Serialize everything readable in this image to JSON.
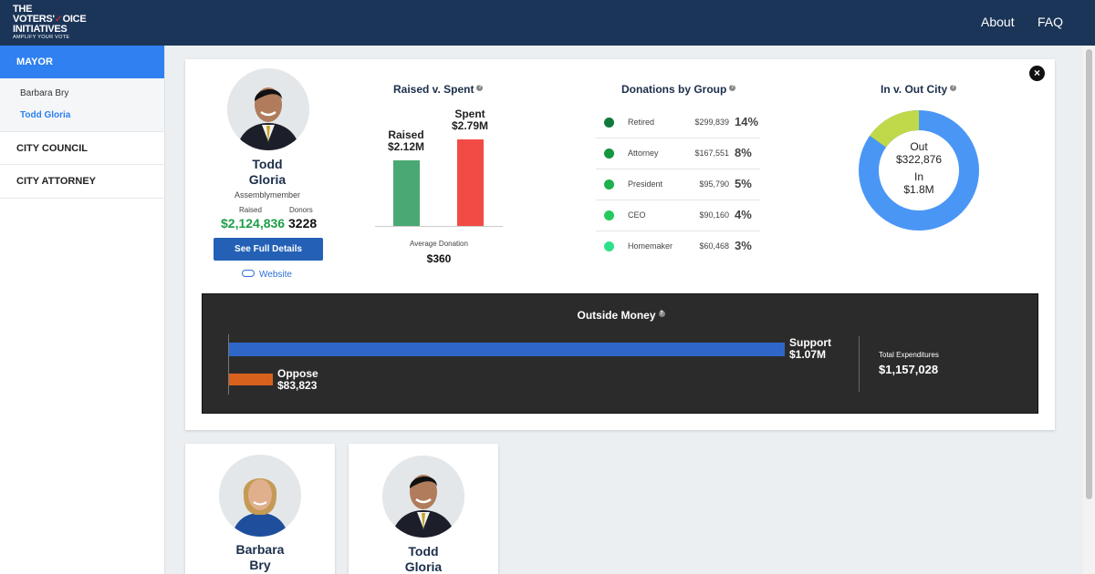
{
  "logo": {
    "line1": "THE",
    "line2a": "VOTERS'",
    "line2b": "OICE",
    "line3": "INITIATIVES",
    "tagline": "AMPLIFY YOUR VOTE"
  },
  "nav": {
    "about": "About",
    "faq": "FAQ"
  },
  "sidebar": {
    "mayor": "MAYOR",
    "mayor_candidates": [
      {
        "label": "Barbara Bry"
      },
      {
        "label": "Todd Gloria"
      }
    ],
    "city_council": "CITY COUNCIL",
    "city_attorney": "CITY ATTORNEY"
  },
  "candidate": {
    "first_name": "Todd",
    "last_name": "Gloria",
    "office": "Assemblymember",
    "raised_label": "Raised",
    "raised_value": "$2,124,836",
    "donors_label": "Donors",
    "donors_value": "3228",
    "details_button": "See Full Details",
    "website_label": "Website"
  },
  "raised_spent": {
    "title": "Raised v. Spent",
    "help": "?",
    "raised_label": "Raised",
    "raised_value": "$2.12M",
    "spent_label": "Spent",
    "spent_value": "$2.79M",
    "avg_label": "Average Donation",
    "avg_value": "$360"
  },
  "donations": {
    "title": "Donations by Group",
    "help": "?",
    "rows": [
      {
        "name": "Retired",
        "amount": "$299,839",
        "pct": "14%",
        "color": "#0f7a3c"
      },
      {
        "name": "Attorney",
        "amount": "$167,551",
        "pct": "8%",
        "color": "#15963f"
      },
      {
        "name": "President",
        "amount": "$95,790",
        "pct": "5%",
        "color": "#1eb04d"
      },
      {
        "name": "CEO",
        "amount": "$90,160",
        "pct": "4%",
        "color": "#25c95c"
      },
      {
        "name": "Homemaker",
        "amount": "$60,468",
        "pct": "3%",
        "color": "#2fe08a"
      }
    ]
  },
  "in_out_city": {
    "title": "In v. Out City",
    "help": "?",
    "out_label": "Out",
    "out_value": "$322,876",
    "in_label": "In",
    "in_value": "$1.8M",
    "colors": {
      "in": "#4a96f5",
      "out": "#bfd94a"
    }
  },
  "outside_money": {
    "title": "Outside Money",
    "help": "?",
    "support_label": "Support",
    "support_value": "$1.07M",
    "oppose_label": "Oppose",
    "oppose_value": "$83,823",
    "total_label": "Total Expenditures",
    "total_value": "$1,157,028",
    "colors": {
      "support": "#2f67c9",
      "oppose": "#d9611e"
    }
  },
  "candidate_cards": [
    {
      "first_name": "Barbara",
      "last_name": "Bry"
    },
    {
      "first_name": "Todd",
      "last_name": "Gloria"
    }
  ],
  "close_icon": "×"
}
